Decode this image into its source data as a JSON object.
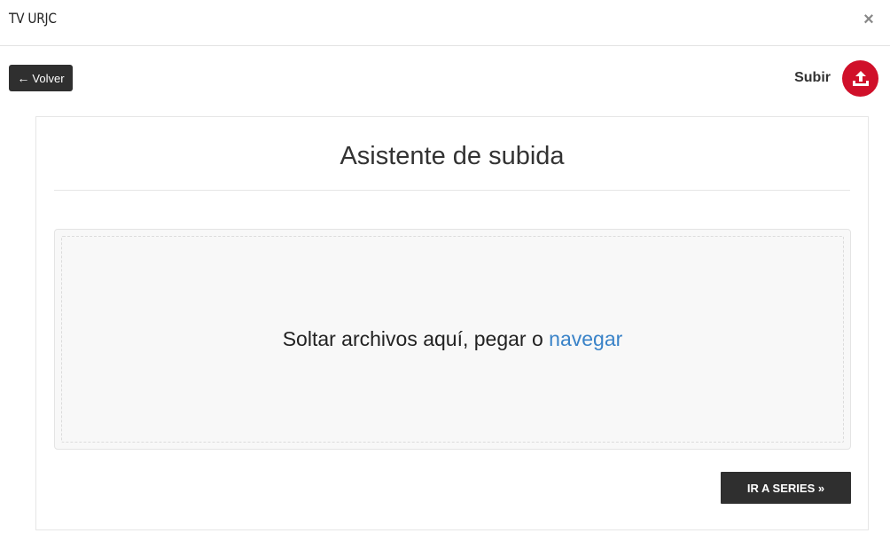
{
  "header": {
    "title": "TV URJC",
    "close_icon": "×"
  },
  "toolbar": {
    "back_label": "Volver",
    "back_icon": "←",
    "upload_label": "Subir",
    "upload_icon": "upload-icon",
    "upload_color": "#d0102a"
  },
  "wizard": {
    "title": "Asistente de subida",
    "dropzone_text": "Soltar archivos aquí, pegar o ",
    "browse_link": "navegar",
    "next_button": "IR A SERIES »"
  },
  "colors": {
    "link": "#3a83c8",
    "dark_button": "#2f2f2f"
  }
}
